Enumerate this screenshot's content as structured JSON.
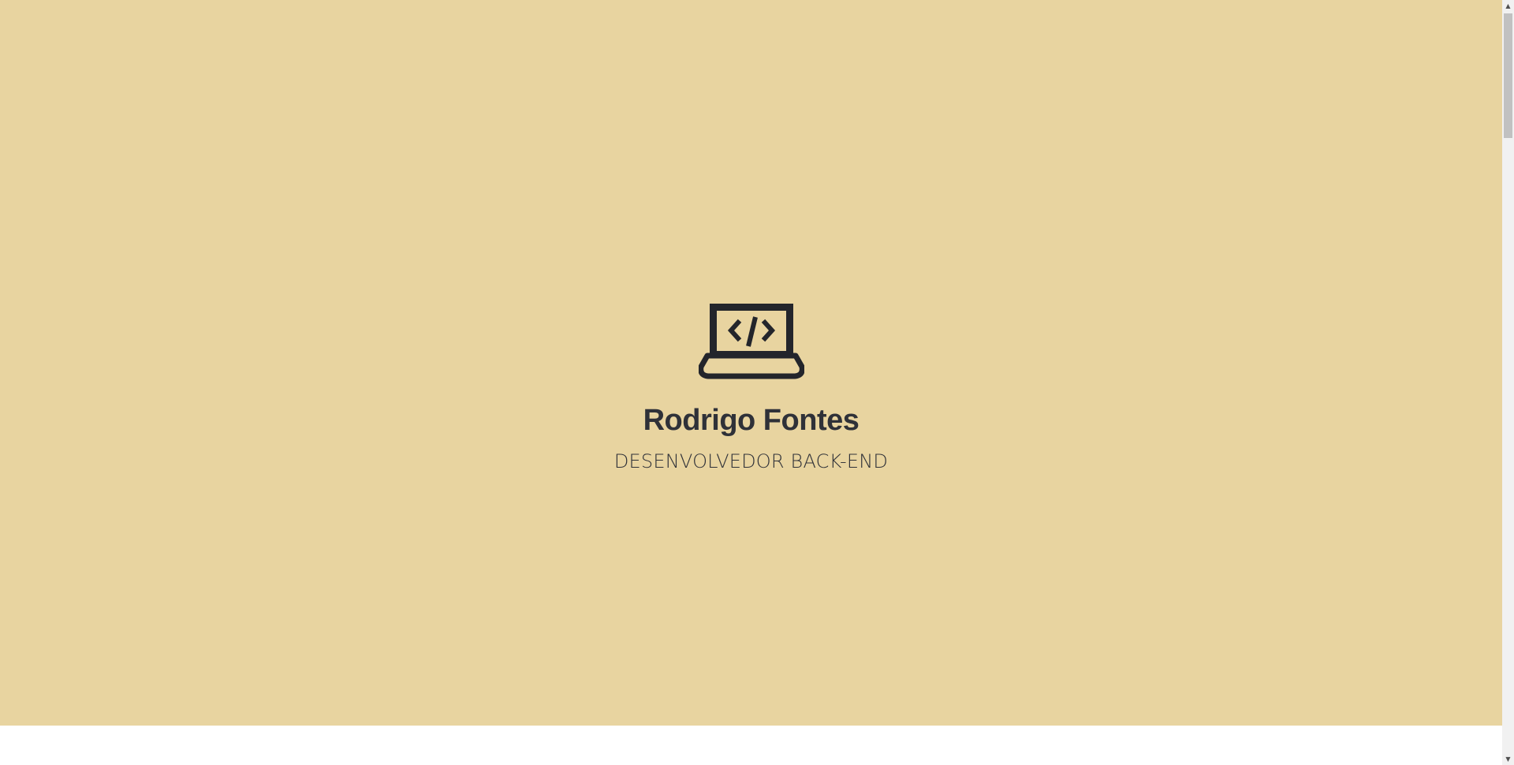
{
  "hero": {
    "icon": "laptop-code-icon",
    "name": "Rodrigo Fontes",
    "subtitle": "DESENVOLVEDOR BACK-END",
    "background_color": "#e8d4a0",
    "text_color": "#2f3138"
  },
  "scrollbar": {
    "up_glyph": "▲",
    "down_glyph": "▼"
  }
}
